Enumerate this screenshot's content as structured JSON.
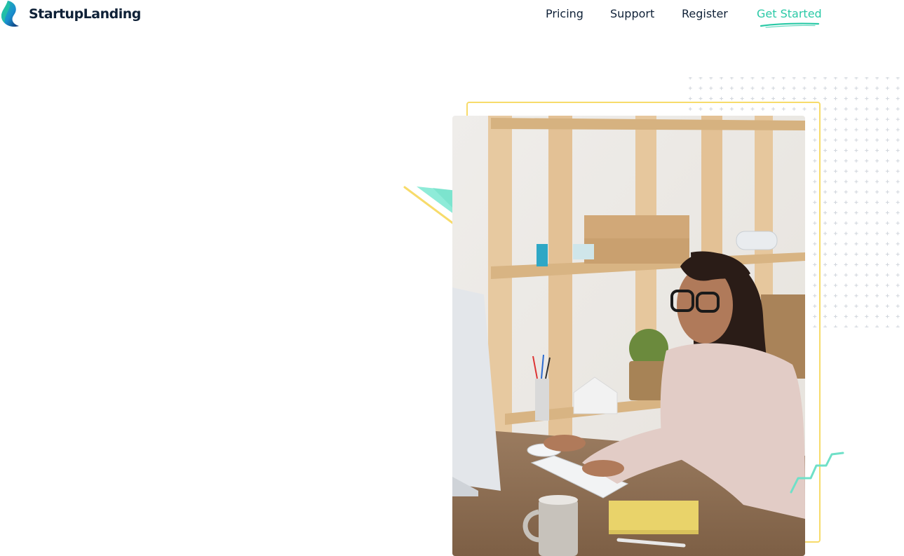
{
  "brand": {
    "name": "StartupLanding",
    "logo_colors": [
      "#23c3a3",
      "#1a7fd0",
      "#0f2d6b"
    ]
  },
  "nav": {
    "items": [
      {
        "label": "Pricing"
      },
      {
        "label": "Support"
      },
      {
        "label": "Register"
      },
      {
        "label": "Get Started",
        "active": true
      }
    ]
  },
  "colors": {
    "text": "#0f2137",
    "accent": "#2ac9a6",
    "frame": "#f7db6a",
    "dots": "#cfd4db"
  },
  "hero": {
    "image_subject": "woman-at-desk-photo"
  }
}
